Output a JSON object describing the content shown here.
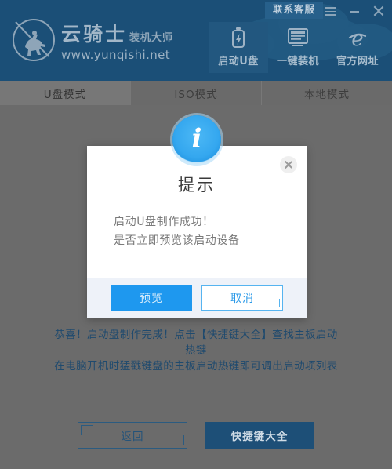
{
  "app": {
    "brand_cn": "云骑士",
    "brand_cn_sub": "装机大师",
    "brand_url": "www.yunqishi.net",
    "logo_icon": "knight-on-horse-circle-logo"
  },
  "titlebar": {
    "contact_label": "联系客服",
    "menu_icon": "hamburger-menu-icon",
    "minimize_icon": "minimize-icon",
    "close_icon": "close-icon"
  },
  "nav": {
    "items": [
      {
        "label": "启动U盘",
        "icon": "usb-drive-icon",
        "active": true
      },
      {
        "label": "一键装机",
        "icon": "monitor-document-icon",
        "active": false
      },
      {
        "label": "官方网址",
        "icon": "internet-explorer-icon",
        "active": false
      }
    ]
  },
  "tabs": {
    "items": [
      {
        "label": "U盘模式",
        "active": true
      },
      {
        "label": "ISO模式",
        "active": false
      },
      {
        "label": "本地模式",
        "active": false
      }
    ]
  },
  "content": {
    "tip_line_1": "恭喜！启动盘制作完成！点击【快捷键大全】查找主板启动",
    "tip_line_1b": "热键",
    "tip_line_2": "在电脑开机时猛戳键盘的主板启动热键即可调出启动项列表",
    "back_button": "返回",
    "hotkey_button": "快捷键大全"
  },
  "dialog": {
    "icon": "info-circle-icon",
    "icon_glyph": "i",
    "close_icon": "close-icon",
    "title": "提示",
    "message_line_1": "启动U盘制作成功！",
    "message_line_2": "是否立即预览该启动设备",
    "confirm_label": "预览",
    "cancel_label": "取消"
  },
  "colors": {
    "header_blue": "#1b4f77",
    "accent_blue": "#1e98ef",
    "dim_overlay": "#6b6b6b",
    "tab_bar": "#6a6a6a",
    "modal_footer": "#eef2f9"
  }
}
